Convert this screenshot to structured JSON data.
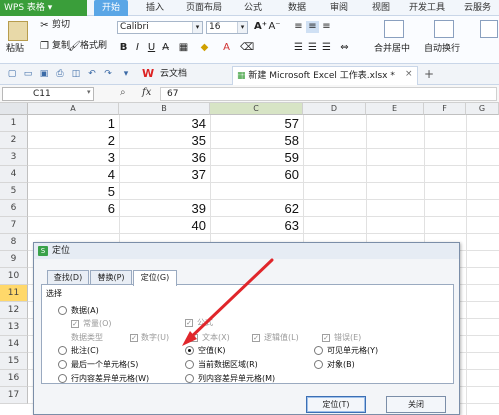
{
  "app": {
    "menu_button": "WPS 表格"
  },
  "menu_tabs": [
    "开始",
    "插入",
    "页面布局",
    "公式",
    "数据",
    "审阅",
    "视图",
    "开发工具",
    "云服务"
  ],
  "ribbon": {
    "cut": "剪切",
    "copy": "复制",
    "format_painter": "格式刷",
    "paste": "粘贴",
    "font_name": "Calibri",
    "font_size": "16",
    "merge_center": "合并居中",
    "wrap_text": "自动换行"
  },
  "tabstrip": {
    "cloud_doc": "云文档",
    "doc_tab": "新建 Microsoft Excel 工作表.xlsx *",
    "add": "+"
  },
  "formula_bar": {
    "cell_ref": "C11",
    "fx": "fx",
    "value": "67"
  },
  "sheet": {
    "columns": [
      "A",
      "B",
      "C",
      "D",
      "E",
      "F",
      "G"
    ],
    "rows": [
      "1",
      "2",
      "3",
      "4",
      "5",
      "6",
      "7",
      "8",
      "9",
      "10",
      "11",
      "12",
      "13",
      "14",
      "15",
      "16",
      "17"
    ],
    "col_a": [
      "1",
      "2",
      "3",
      "4",
      "5",
      "6",
      "",
      "",
      "",
      "",
      "",
      "",
      "",
      "",
      "",
      "",
      ""
    ],
    "col_b": [
      "34",
      "35",
      "36",
      "37",
      "",
      "39",
      "40",
      "",
      "",
      "",
      "",
      "",
      "",
      "",
      "",
      "",
      ""
    ],
    "col_c": [
      "57",
      "58",
      "59",
      "60",
      "",
      "62",
      "63",
      "",
      "",
      "",
      "",
      "",
      "",
      "",
      "",
      "",
      ""
    ]
  },
  "dialog": {
    "title": "定位",
    "tabs": [
      "查找(D)",
      "替换(P)",
      "定位(G)"
    ],
    "group_label": "选择",
    "options": {
      "data": "数据(A)",
      "formula": "公式",
      "constant": "常量(O)",
      "data_type": "数据类型",
      "number": "数字(U)",
      "text": "文本(X)",
      "logical": "逻辑值(L)",
      "error": "错误(E)",
      "comment": "批注(C)",
      "blank": "空值(K)",
      "visible_cells": "可见单元格(Y)",
      "last_cell": "最后一个单元格(S)",
      "current_region": "当前数据区域(R)",
      "objects": "对象(B)",
      "row_diff": "行内容差异单元格(W)",
      "col_diff": "列内容差异单元格(M)"
    },
    "ok_button": "定位(T)",
    "close_button": "关闭"
  },
  "colors": {
    "accent_green": "#3a9e3a",
    "arrow_red": "#e0262b",
    "selected_row": "#ffd86a"
  }
}
